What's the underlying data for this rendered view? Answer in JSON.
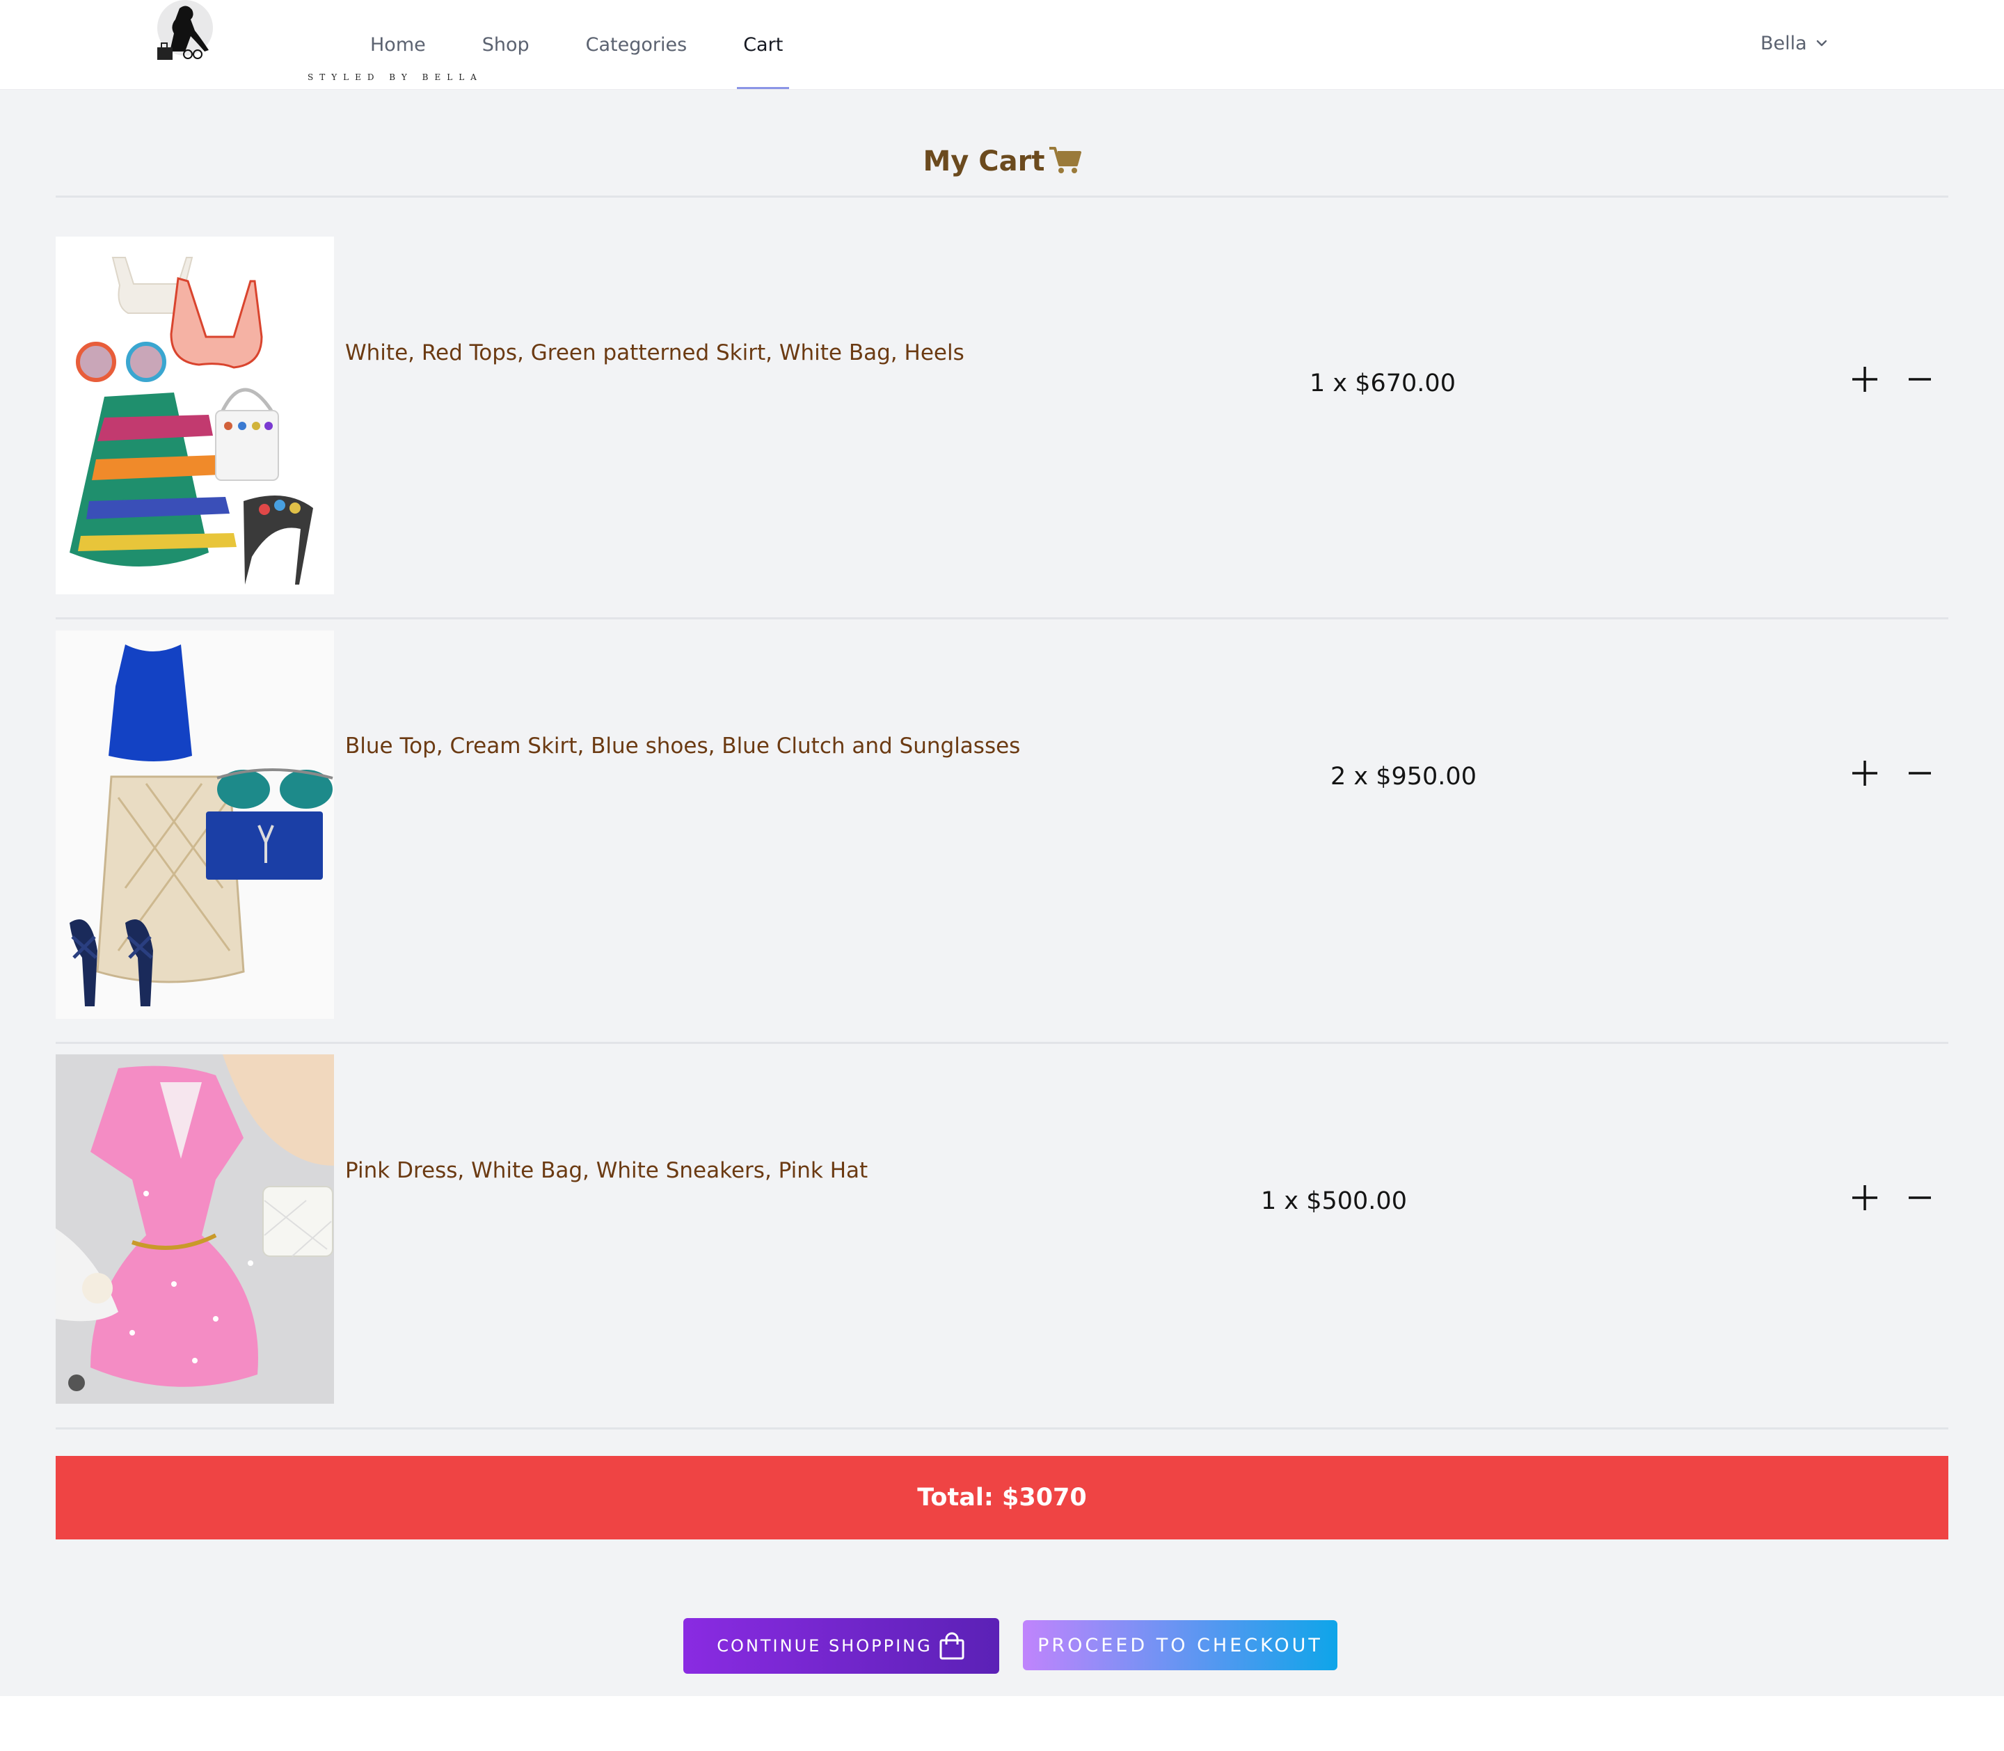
{
  "brand": {
    "tagline": "STYLED BY BELLA"
  },
  "nav": {
    "links": [
      {
        "label": "Home"
      },
      {
        "label": "Shop"
      },
      {
        "label": "Categories"
      },
      {
        "label": "Cart",
        "active": true
      }
    ],
    "user": "Bella"
  },
  "cart": {
    "title": "My Cart",
    "items": [
      {
        "name": "White, Red Tops, Green patterned Skirt, White Bag, Heels",
        "price": "1 x $670.00"
      },
      {
        "name": "Blue Top, Cream Skirt, Blue shoes, Blue Clutch and Sunglasses",
        "price": "2 x $950.00"
      },
      {
        "name": "Pink Dress, White Bag, White Sneakers, Pink Hat",
        "price": "1 x $500.00"
      }
    ],
    "total": "Total: $3070"
  },
  "actions": {
    "continue_label": "CONTINUE SHOPPING",
    "checkout_label": "PROCEED TO CHECKOUT"
  },
  "colors": {
    "accent": "#8b95e6",
    "title": "#6b4a1e",
    "item_name": "#6b3a12",
    "total_bar": "#ef4444",
    "continue_button": "#7c22d8",
    "checkout_button_start": "#c084fc",
    "checkout_button_end": "#0ea5e9"
  }
}
